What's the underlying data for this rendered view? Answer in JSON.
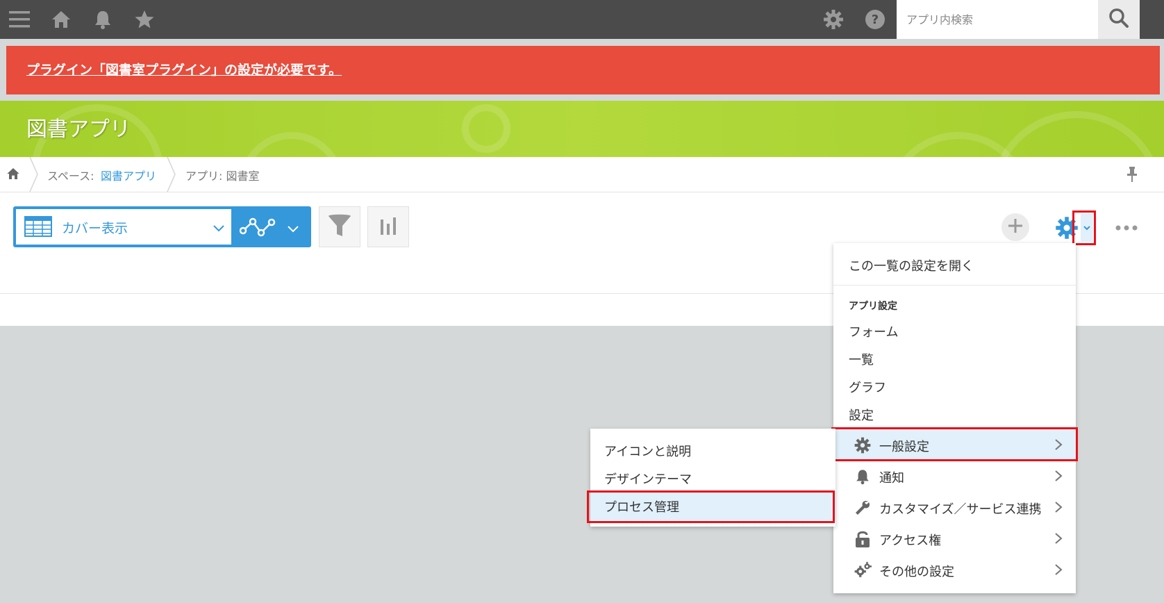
{
  "topbar": {
    "search_placeholder": "アプリ内検索",
    "icons": [
      "menu-icon",
      "home-icon",
      "bell-icon",
      "star-icon",
      "gear-icon",
      "help-icon",
      "search-icon"
    ]
  },
  "alert": {
    "text": "プラグイン「図書室プラグイン」の設定が必要です。"
  },
  "header": {
    "title": "図書アプリ"
  },
  "breadcrumb": {
    "space_prefix": "スペース:",
    "space_name": "図書アプリ",
    "app_label": "アプリ: 図書室"
  },
  "toolbar": {
    "view_name": "カバー表示"
  },
  "dropdown": {
    "open_view_settings": "この一覧の設定を開く",
    "section_title": "アプリ設定",
    "items": [
      "フォーム",
      "一覧",
      "グラフ",
      "設定"
    ],
    "submenus": [
      {
        "label": "一般設定",
        "icon": "gear-icon",
        "highlighted": true
      },
      {
        "label": "通知",
        "icon": "bell-icon"
      },
      {
        "label": "カスタマイズ／サービス連携",
        "icon": "wrench-icon"
      },
      {
        "label": "アクセス権",
        "icon": "lock-icon"
      },
      {
        "label": "その他の設定",
        "icon": "gears-icon"
      }
    ]
  },
  "submenu": {
    "items": [
      "アイコンと説明",
      "デザインテーマ",
      "プロセス管理"
    ],
    "highlighted_index": 2
  },
  "colors": {
    "topbar": "#4b4b4b",
    "alert": "#e74c3c",
    "header": "#a4cf2c",
    "accent": "#3498db",
    "highlight": "#e1f0fa",
    "annotation": "#e5121c"
  }
}
